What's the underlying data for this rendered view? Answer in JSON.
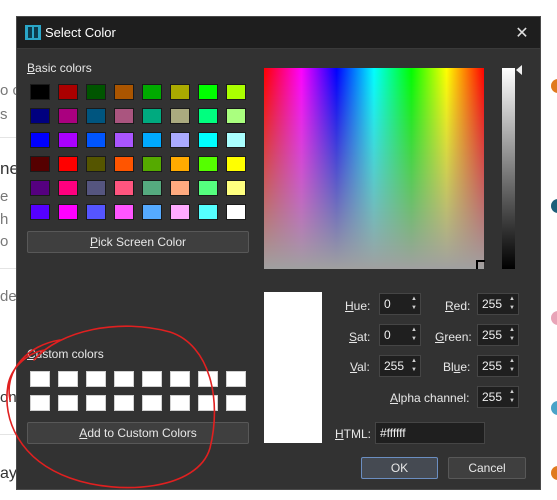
{
  "background": {
    "frags": [
      "o c",
      "s",
      "ne",
      "e",
      "h",
      "o",
      "de",
      "on",
      "ay"
    ]
  },
  "dialog": {
    "title": "Select Color",
    "close_glyph": "✕",
    "basic_colors_label": "Basic colors",
    "custom_colors_label": "Custom colors",
    "pick_screen_button": "Pick Screen Color",
    "add_custom_button": "Add to Custom Colors",
    "basic_swatches": [
      "#000000",
      "#aa0000",
      "#005500",
      "#aa5500",
      "#00aa00",
      "#aaaa00",
      "#00ff00",
      "#aaff00",
      "#00007f",
      "#aa007f",
      "#00557f",
      "#aa557f",
      "#00aa7f",
      "#aaaa7f",
      "#00ff7f",
      "#aaff7f",
      "#0000ff",
      "#aa00ff",
      "#0055ff",
      "#aa55ff",
      "#00aaff",
      "#aaaaff",
      "#00ffff",
      "#aaffff",
      "#550000",
      "#ff0000",
      "#555500",
      "#ff5500",
      "#55aa00",
      "#ffaa00",
      "#55ff00",
      "#ffff00",
      "#55007f",
      "#ff007f",
      "#55557f",
      "#ff557f",
      "#55aa7f",
      "#ffaa7f",
      "#55ff7f",
      "#ffff7f",
      "#5500ff",
      "#ff00ff",
      "#5555ff",
      "#ff55ff",
      "#55aaff",
      "#ffaaff",
      "#55ffff",
      "#ffffff"
    ],
    "custom_swatch_count": 16,
    "fields": {
      "hue_label": "Hue:",
      "hue_value": "0",
      "sat_label": "Sat:",
      "sat_value": "0",
      "val_label": "Val:",
      "val_value": "255",
      "red_label": "Red:",
      "red_value": "255",
      "green_label": "Green:",
      "green_value": "255",
      "blue_label": "Blue:",
      "blue_value": "255",
      "alpha_label": "Alpha channel:",
      "alpha_value": "255",
      "html_label": "HTML:",
      "html_value": "#ffffff"
    },
    "ok_button": "OK",
    "cancel_button": "Cancel",
    "current_color": "#ffffff",
    "annotation_color": "#e02020"
  }
}
